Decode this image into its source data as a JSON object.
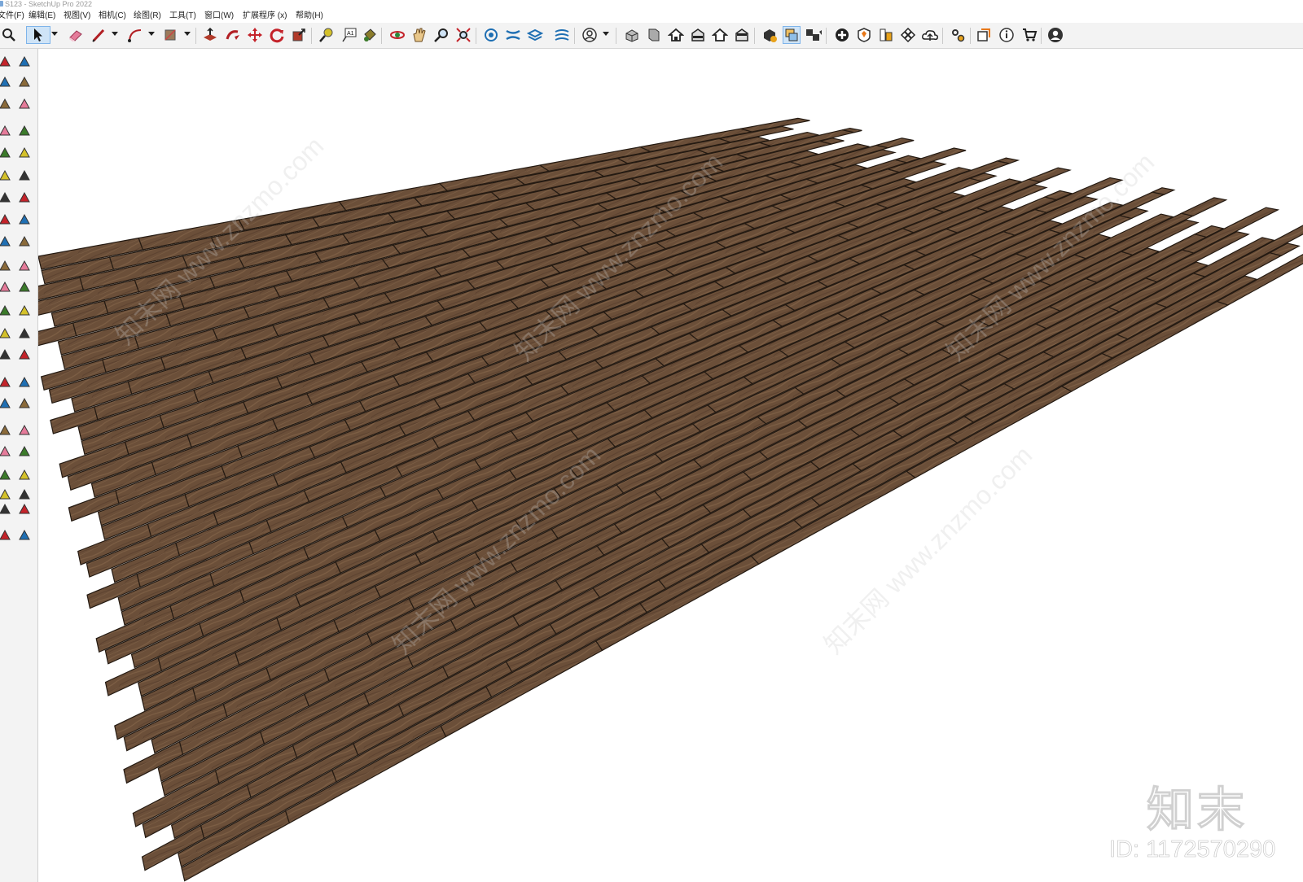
{
  "window": {
    "title": "S123 - SketchUp Pro 2022"
  },
  "menubar": [
    {
      "label": "文件(F)"
    },
    {
      "label": "编辑(E)"
    },
    {
      "label": "视图(V)"
    },
    {
      "label": "相机(C)"
    },
    {
      "label": "绘图(R)"
    },
    {
      "label": "工具(T)"
    },
    {
      "label": "窗口(W)"
    },
    {
      "label": "扩展程序 (x)"
    },
    {
      "label": "帮助(H)"
    }
  ],
  "toolbar": {
    "icons": [
      "zoom-icon",
      "select-icon",
      "eraser-icon",
      "line-icon",
      "arc-icon",
      "rectangle-icon",
      "push-pull-icon",
      "follow-me-icon",
      "move-icon",
      "rotate-icon",
      "scale-icon",
      "tape-measure-icon",
      "text-icon",
      "paint-bucket-icon",
      "orbit-icon",
      "pan-icon",
      "zoom-tool-icon",
      "zoom-extents-icon",
      "sandbox-icon",
      "sandbox-smoove-icon",
      "sandbox-stamp-icon",
      "sandbox-drape-icon",
      "account-icon",
      "iso-view-icon",
      "front-view-icon",
      "home-icon",
      "right-view-icon",
      "back-view-icon",
      "left-view-icon",
      "component-icon",
      "section-plane-icon",
      "section-display-icon",
      "add-location-icon",
      "warehouse-icon",
      "extension-warehouse-icon",
      "style-builder-icon",
      "cloud-icon",
      "settings-icon",
      "layout-icon",
      "info-icon",
      "cart-icon",
      "user-icon"
    ]
  },
  "viewport": {
    "floor_material": "wood-plank",
    "colors": {
      "wood": "#6a4e38",
      "wood_light": "#7a5c43",
      "seam": "#241a12",
      "background": "#ffffff"
    }
  },
  "watermark": {
    "logo": "知末",
    "id": "ID: 1172570290",
    "site": "知末网 www.znzmo.com"
  }
}
